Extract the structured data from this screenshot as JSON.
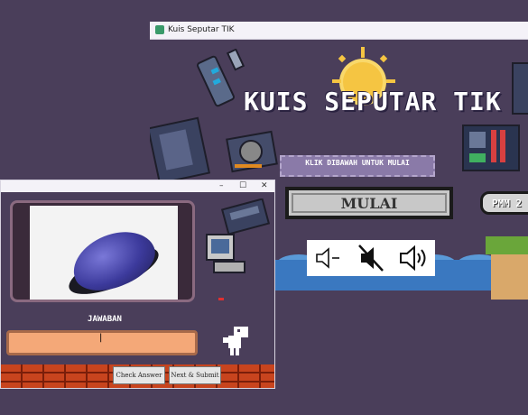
{
  "main_window": {
    "title": "Kuis Seputar TIK",
    "banner_title": "KUIS SEPUTAR TIK",
    "subtitle": "KLIK DIBAWAH UNTUK MULAI",
    "start_button": "MULAI",
    "badge": "PMM 2"
  },
  "volume_controls": [
    {
      "name": "volume-down",
      "icon": "speaker-minus-icon"
    },
    {
      "name": "mute",
      "icon": "speaker-mute-icon"
    },
    {
      "name": "volume-up",
      "icon": "speaker-wave-icon"
    }
  ],
  "quiz_window": {
    "window_controls": [
      "–",
      "☐",
      "✕"
    ],
    "question_image": "computer-mouse",
    "answer_label": "JAWABAN",
    "answer_value": "|",
    "check_button": "Check Answer",
    "next_button": "Next & Submit"
  },
  "colors": {
    "background": "#4a3e5a",
    "input": "#f4a878",
    "bricks": "#c8441e",
    "water": "#3a78c0"
  }
}
